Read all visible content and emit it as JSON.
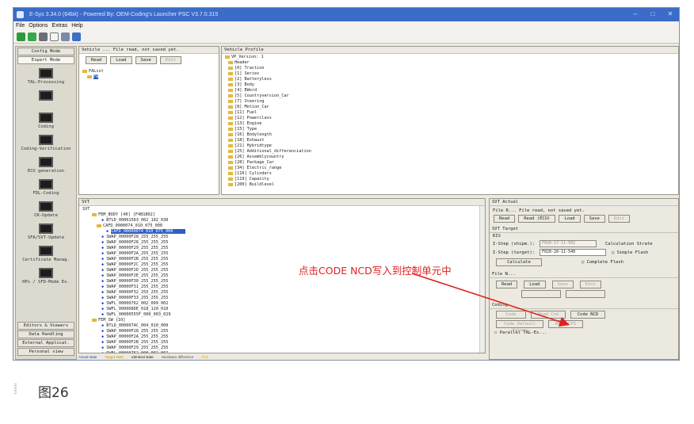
{
  "window": {
    "title": "E-Sys 3.34.0 (64bit) - Powered By: OEM-Coding's Launcher PSC V3.7.0.315"
  },
  "menu": [
    "File",
    "Options",
    "Extras",
    "Help"
  ],
  "sidebar": {
    "top_buttons": [
      "Config Mode",
      "Expert Mode"
    ],
    "sections": [
      "TAL-Processing",
      "",
      "Coding",
      "Coding-Verification",
      "ECU generation",
      "FDL-Coding",
      "CR-Update",
      "SFA/SVT-Update",
      "Certificate Manag.",
      "HPs / SFD-Mode Ex."
    ],
    "bottom_buttons": [
      "Editors & Viewers",
      "Data Handling",
      "External Applicat.",
      "Personal view"
    ]
  },
  "fa_panel": {
    "header": "Vehicle ... File read, not saved yet.",
    "buttons": [
      "Read",
      "Load",
      "Save",
      "Edit"
    ],
    "tree": [
      "FAList",
      "FA"
    ]
  },
  "vp_panel": {
    "header": "Vehicle Profile",
    "items": [
      "VP_Version: 1",
      "Header",
      "[0] Traction",
      "[1] Series",
      "[2] Batteryless",
      "[3] Body",
      "[4] EWord",
      "[5] Countryversion_Car",
      "[7] Steering",
      "[8] Motion_Car",
      "[11] Fuel",
      "[12] Powerclass",
      "[13] Engine",
      "[15] Type",
      "[16] Bodylength",
      "[18] Exhaust",
      "[21] Hybridtype",
      "[25] Additional_differenciation",
      "[26] Assemblycountry",
      "[28] Package_Car",
      "[34] Electric_range",
      "[116] Cylinders",
      "[119] Capacity",
      "[200] Buildlevel"
    ]
  },
  "svt_panel": {
    "header": "SVT",
    "root": "SVT",
    "lines": [
      "FEM_BODY [40] [F4B1B02]",
      "BTLD_00001563_002_102_030",
      "CAFD_0000074_010_075_000",
      "CAFD_00000074_010_075_000",
      "SWAP_00000F28_255_255_255",
      "SWAP_00000F28_255_255_255",
      "SWAP_00000F29_255_255_255",
      "SWAP_00000F2A_255_255_255",
      "SWAP_00000F2B_255_255_255",
      "SWAP_00000F2C_255_255_255",
      "SWAP_00000F2D_255_255_255",
      "SWAP_00000F2E_255_255_255",
      "SWAP_00000F30_255_255_255",
      "SWAP_00000F31_255_255_255",
      "SWAP_00000F32_255_255_255",
      "SWAP_00000F33_255_255_255",
      "SWFL_00000762_002_009_002",
      "SWFL_000008DE_018_120_010",
      "SWFL_00000555F_000_003_029",
      "FEM_SW [10]",
      "BTLD_0000074C_004_010_000",
      "SWAP_00000F28_255_255_255",
      "SWAP_00000F2A_255_255_255",
      "SWAP_00000F2B_255_255_255",
      "SWAP_00000F29_255_255_255",
      "SWFL_00000762_000_002_002",
      "SWFL_0000078B_004_010_550"
    ],
    "legend": [
      "Actual state",
      "Target state",
      "Identical state",
      "Hardware difference",
      "TAS"
    ]
  },
  "svt_actual": {
    "header": "SVT Actual",
    "status": "File R... File read, not saved yet.",
    "buttons": [
      "Read",
      "Read (ECU)",
      "Load",
      "Save",
      "Edit"
    ]
  },
  "svt_target": {
    "header": "SVT Target",
    "kis": "KIS",
    "istep_shipm_label": "I-Step (shipm.):",
    "istep_shipm_value": "F020-17-11-502",
    "istep_target_label": "I-Step (target):",
    "istep_target_value": "F020-20-11-540",
    "calculate": "Calculate",
    "calc_strategy": "Calculation Strate",
    "radio_simple": "Simple Flash",
    "radio_complete": "Complete Flash"
  },
  "file_panel": {
    "header": "File N...",
    "buttons": [
      "Read",
      "Load",
      "Save",
      "Edit"
    ],
    "disabled_buttons": [
      "",
      ""
    ]
  },
  "coding_panel": {
    "header": "Coding",
    "buttons_row1": [
      "Code",
      "Read Cod",
      "Code NCD"
    ],
    "buttons_row2": [
      "Code Default Values",
      "Read CPS"
    ],
    "checkbox": "Parallel TAL-Ex..."
  },
  "annotation": "点击CODE NCD写入到控制单元中",
  "caption": "图26",
  "colors": {
    "title_bar": "#3a6cc8",
    "annotation": "#e02020",
    "selection": "#2f5ec6"
  }
}
